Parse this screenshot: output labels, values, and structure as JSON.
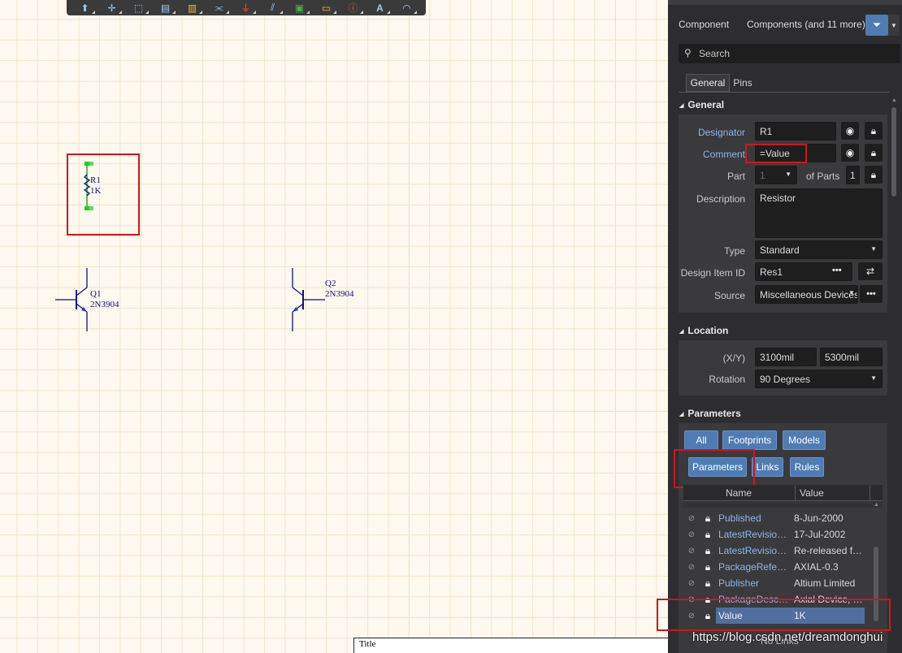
{
  "panel": {
    "header_label": "Component",
    "header_filter": "Components (and 11 more)",
    "search_placeholder": "Search",
    "tabs": [
      "General",
      "Pins"
    ],
    "general": {
      "title": "General",
      "designator_label": "Designator",
      "designator_value": "R1",
      "comment_label": "Comment",
      "comment_value": "=Value",
      "part_label": "Part",
      "part_value": "1",
      "of_parts_label": "of Parts",
      "of_parts_value": "1",
      "description_label": "Description",
      "description_value": "Resistor",
      "type_label": "Type",
      "type_value": "Standard",
      "design_item_label": "Design Item ID",
      "design_item_value": "Res1",
      "source_label": "Source",
      "source_value": "Miscellaneous Devices"
    },
    "location": {
      "title": "Location",
      "xy_label": "(X/Y)",
      "x_value": "3100mil",
      "y_value": "5300mil",
      "rotation_label": "Rotation",
      "rotation_value": "90 Degrees"
    },
    "parameters": {
      "title": "Parameters",
      "filters": [
        "All",
        "Footprints",
        "Models",
        "Parameters",
        "Links",
        "Rules"
      ],
      "col_name": "Name",
      "col_value": "Value",
      "rows": [
        {
          "name": "Published",
          "value": "8-Jun-2000"
        },
        {
          "name": "LatestRevisionDate",
          "value": "17-Jul-2002"
        },
        {
          "name": "LatestRevisionNote",
          "value": "Re-released for DXP Platform."
        },
        {
          "name": "PackageReference",
          "value": "AXIAL-0.3"
        },
        {
          "name": "Publisher",
          "value": "Altium Limited"
        },
        {
          "name": "PackageDescription",
          "value": "Axial Device, Thru-Hole"
        },
        {
          "name": "Value",
          "value": "1K"
        }
      ],
      "no_links": "No Links"
    }
  },
  "canvas": {
    "r1_designator": "R1",
    "r1_value": "1K",
    "q1_designator": "Q1",
    "q1_value": "2N3904",
    "q2_designator": "Q2",
    "q2_value": "2N3904",
    "title_block": "Title"
  },
  "watermark": "https://blog.csdn.net/dreamdonghui",
  "colors": {
    "canvas_bg": "#fdf9ef",
    "panel_bg": "#2d2d30",
    "accent_blue": "#4f7cb3",
    "highlight_red": "#d0151e",
    "wire_blue": "#10107a"
  }
}
